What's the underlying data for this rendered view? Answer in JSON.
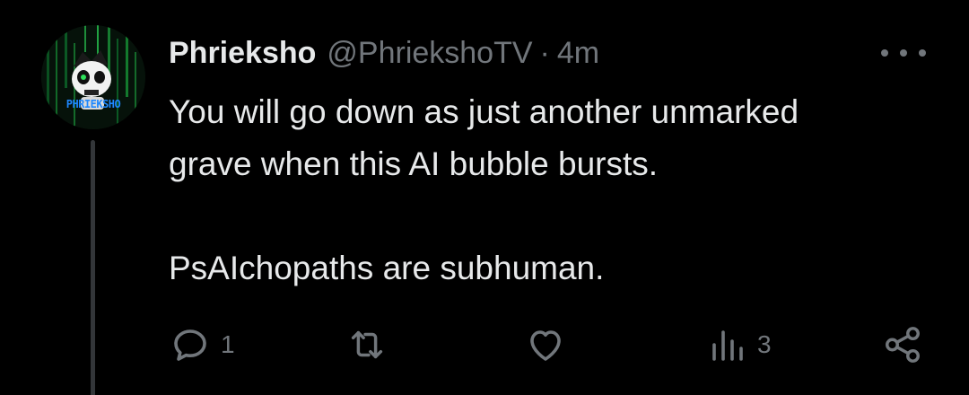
{
  "colors": {
    "background": "#000000",
    "text_primary": "#e7e9ea",
    "text_secondary": "#71767b",
    "thread_line": "#333639"
  },
  "author": {
    "display_name": "Phrieksho",
    "handle": "@PhriekshoTV",
    "separator": "·",
    "time": "4m",
    "avatar_text": "PHRIEKSHO"
  },
  "tweet": {
    "lines": [
      "You will go down as just another unmarked",
      "grave when this AI bubble bursts."
    ],
    "paragraph2": "PsAIchopaths are subhuman."
  },
  "actions": {
    "reply": {
      "icon": "reply-icon",
      "count": "1"
    },
    "retweet": {
      "icon": "retweet-icon",
      "count": ""
    },
    "like": {
      "icon": "heart-icon",
      "count": ""
    },
    "views": {
      "icon": "views-icon",
      "count": "3"
    },
    "share": {
      "icon": "share-icon",
      "count": ""
    }
  }
}
